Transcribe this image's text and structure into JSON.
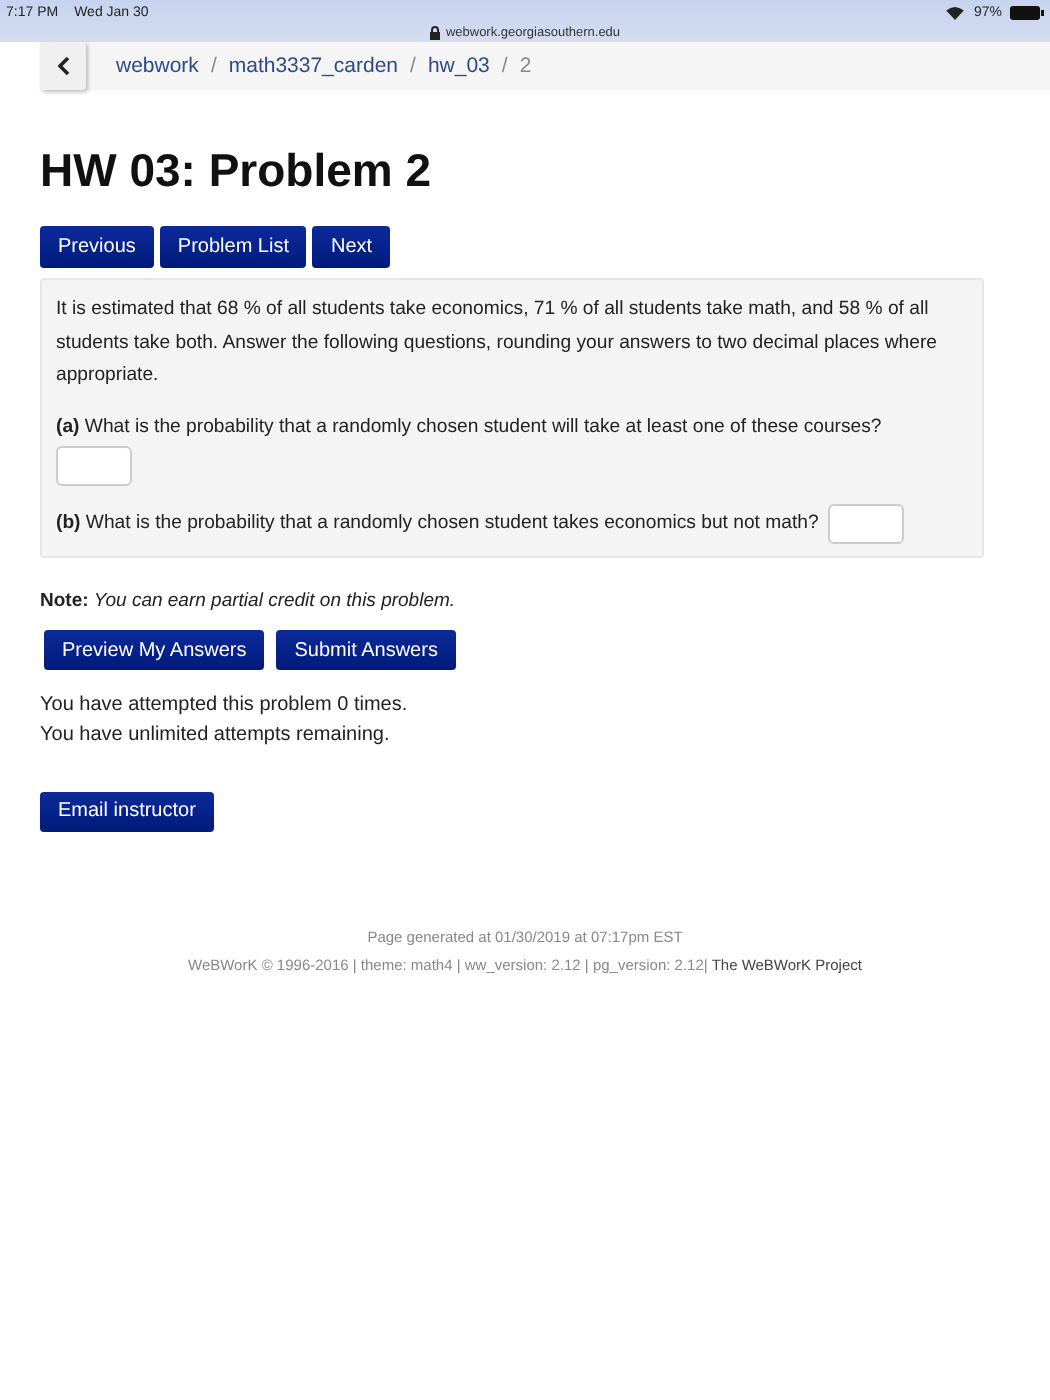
{
  "status_bar": {
    "time": "7:17 PM",
    "date": "Wed Jan 30",
    "battery": "97%"
  },
  "address_bar": {
    "url": "webwork.georgiasouthern.edu"
  },
  "breadcrumb": [
    {
      "label": "webwork",
      "kind": "link"
    },
    {
      "label": "/",
      "kind": "separator"
    },
    {
      "label": "math3337_carden",
      "kind": "link"
    },
    {
      "label": "/",
      "kind": "separator"
    },
    {
      "label": "hw_03",
      "kind": "link"
    },
    {
      "label": "/",
      "kind": "separator"
    },
    {
      "label": "2",
      "kind": "current"
    }
  ],
  "title": "HW 03: Problem 2",
  "nav_buttons": [
    "Previous",
    "Problem List",
    "Next"
  ],
  "problem": {
    "statement": "It is estimated that 68 % of all students take economics, 71 % of all students take math, and 58 % of all students take both. Answer the following questions, rounding your answers to two decimal places where appropriate.",
    "parts": [
      {
        "question": "**(a)** What is the probability that a randomly chosen student will take at least one of these courses?",
        "kind": "below"
      },
      {
        "question": "**(b)** What is the probability that a randomly chosen student takes economics but not math?",
        "kind": "inline"
      }
    ]
  },
  "note": "**Note:** *You can earn partial credit on this problem.*",
  "submit_buttons": [
    "Preview My Answers",
    "Submit Answers"
  ],
  "attempts": [
    "You have attempted this problem 0 times.",
    "You have unlimited attempts remaining."
  ],
  "email_button": "Email instructor",
  "footer": {
    "generated": "Page generated at 01/30/2019 at 07:17pm EST",
    "credits": "WeBWorK © 1996-2016 | theme: math4 | ww_version: 2.12 | pg_version: 2.12|",
    "project_link": "The WeBWorK Project"
  }
}
